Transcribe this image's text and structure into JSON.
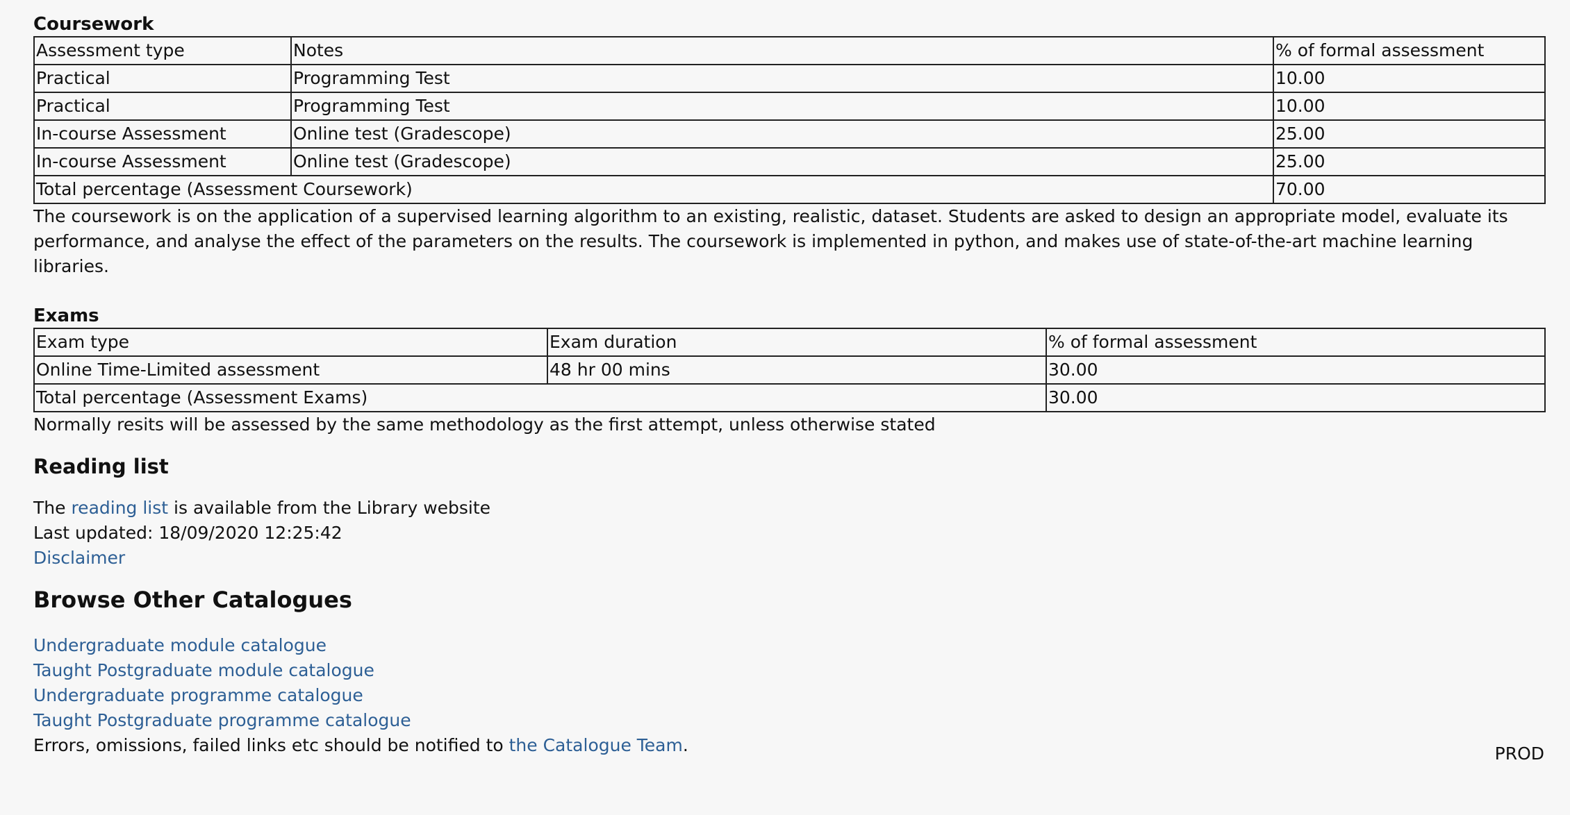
{
  "coursework": {
    "heading": "Coursework",
    "headers": [
      "Assessment type",
      "Notes",
      "% of formal assessment"
    ],
    "rows": [
      [
        "Practical",
        "Programming Test",
        "10.00"
      ],
      [
        "Practical",
        "Programming Test",
        "10.00"
      ],
      [
        "In-course Assessment",
        "Online test (Gradescope)",
        "25.00"
      ],
      [
        "In-course Assessment",
        "Online test (Gradescope)",
        "25.00"
      ]
    ],
    "total_label": "Total percentage (Assessment Coursework)",
    "total_value": "70.00",
    "description": "The coursework is on the application of a supervised learning algorithm to an existing, realistic, dataset. Students are asked to design an appropriate model, evaluate its performance, and analyse the effect of the parameters on the results. The coursework is implemented in python, and makes use of state-of-the-art machine learning libraries."
  },
  "exams": {
    "heading": "Exams",
    "headers": [
      "Exam type",
      "Exam duration",
      "% of formal assessment"
    ],
    "rows": [
      [
        "Online Time-Limited assessment",
        "48 hr 00 mins",
        "30.00"
      ]
    ],
    "total_label": "Total percentage (Assessment Exams)",
    "total_value": "30.00",
    "resits_note": "Normally resits will be assessed by the same methodology as the first attempt, unless otherwise stated"
  },
  "reading_list": {
    "heading": "Reading list",
    "text_before": "The ",
    "link_label": "reading list",
    "text_after": " is available from the Library website",
    "last_updated": "Last updated: 18/09/2020 12:25:42",
    "disclaimer": "Disclaimer"
  },
  "browse": {
    "heading": "Browse Other Catalogues",
    "links": [
      "Undergraduate module catalogue",
      "Taught Postgraduate module catalogue",
      "Undergraduate programme catalogue",
      "Taught Postgraduate programme catalogue"
    ],
    "errors_text_before": "Errors, omissions, failed links etc should be notified to ",
    "errors_link": "the Catalogue Team",
    "errors_text_after": "."
  },
  "env_badge": "PROD",
  "colors": {
    "link": "#2d5f95",
    "background": "#f7f7f7",
    "text": "#111111"
  }
}
